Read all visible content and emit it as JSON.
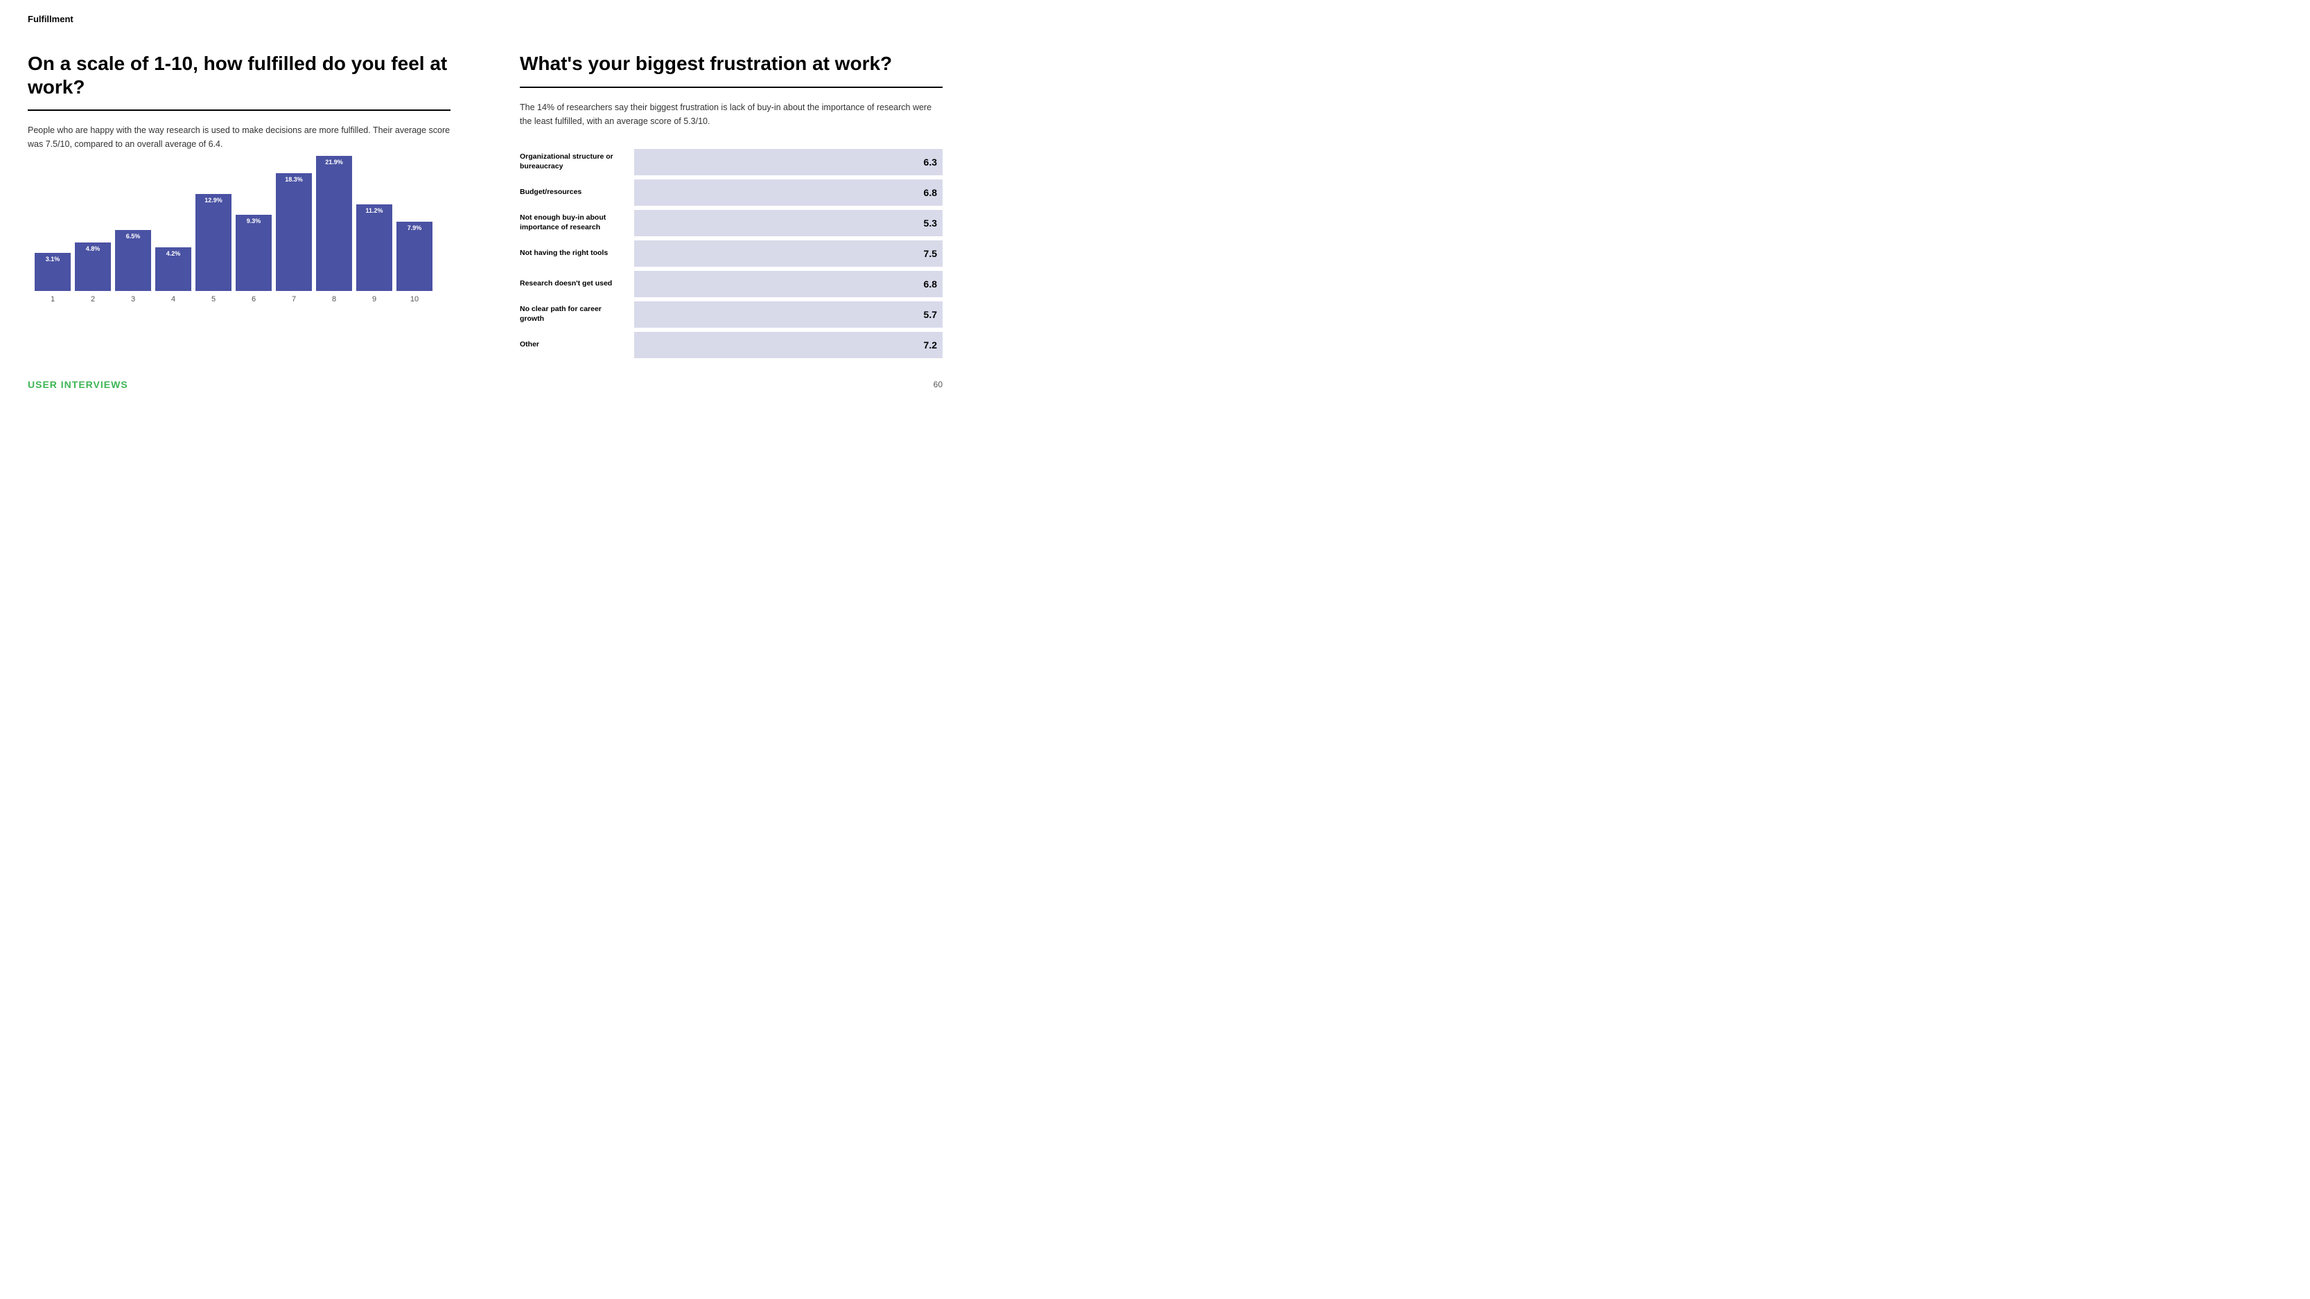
{
  "page": {
    "label": "Fulfillment",
    "page_number": "60"
  },
  "left_section": {
    "title": "On a scale of 1-10, how fulfilled do you feel at work?",
    "description": "People who are happy with the way research is used to make decisions are more fulfilled. Their average score was 7.5/10, compared to an overall average of 6.4.",
    "bars": [
      {
        "x": "1",
        "pct": "3.1%",
        "height": 55
      },
      {
        "x": "2",
        "pct": "4.8%",
        "height": 70
      },
      {
        "x": "3",
        "pct": "6.5%",
        "height": 88
      },
      {
        "x": "4",
        "pct": "4.2%",
        "height": 63
      },
      {
        "x": "5",
        "pct": "12.9%",
        "height": 140
      },
      {
        "x": "6",
        "pct": "9.3%",
        "height": 110
      },
      {
        "x": "7",
        "pct": "18.3%",
        "height": 170
      },
      {
        "x": "8",
        "pct": "21.9%",
        "height": 195
      },
      {
        "x": "9",
        "pct": "11.2%",
        "height": 125
      },
      {
        "x": "10",
        "pct": "7.9%",
        "height": 100
      }
    ]
  },
  "right_section": {
    "title": "What's your biggest frustration at work?",
    "description": "The 14% of researchers say their biggest frustration is lack of buy-in about the importance of research were the least fulfilled, with an average score of 5.3/10.",
    "bars": [
      {
        "label": "Organizational structure or bureaucracy",
        "value": "6.3",
        "width_pct": 92
      },
      {
        "label": "Budget/resources",
        "value": "6.8",
        "width_pct": 99
      },
      {
        "label": "Not enough buy-in about importance of research",
        "value": "5.3",
        "width_pct": 77
      },
      {
        "label": "Not having the right tools",
        "value": "7.5",
        "width_pct": 100
      },
      {
        "label": "Research doesn't get used",
        "value": "6.8",
        "width_pct": 99
      },
      {
        "label": "No clear path for career growth",
        "value": "5.7",
        "width_pct": 83
      },
      {
        "label": "Other",
        "value": "7.2",
        "width_pct": 97
      }
    ]
  },
  "footer": {
    "brand": "USER INTERVIEWS"
  }
}
